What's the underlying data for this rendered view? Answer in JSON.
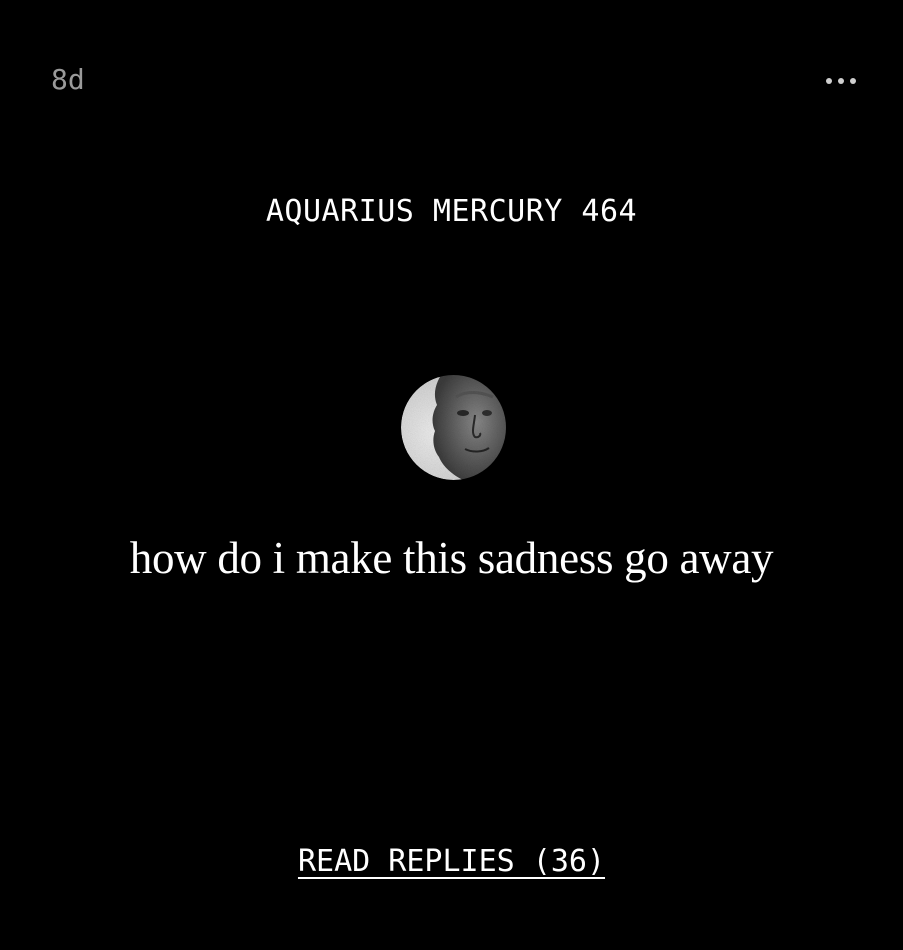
{
  "post": {
    "age": "8d",
    "author": "AQUARIUS MERCURY 464",
    "text": "how do i make this sadness go away",
    "replies_label": "READ REPLIES (36)"
  },
  "icons": {
    "more": "more-horizontal-icon",
    "avatar": "moon-face-avatar"
  },
  "colors": {
    "background": "#000000",
    "text": "#ffffff",
    "muted": "#9a9a9a"
  }
}
